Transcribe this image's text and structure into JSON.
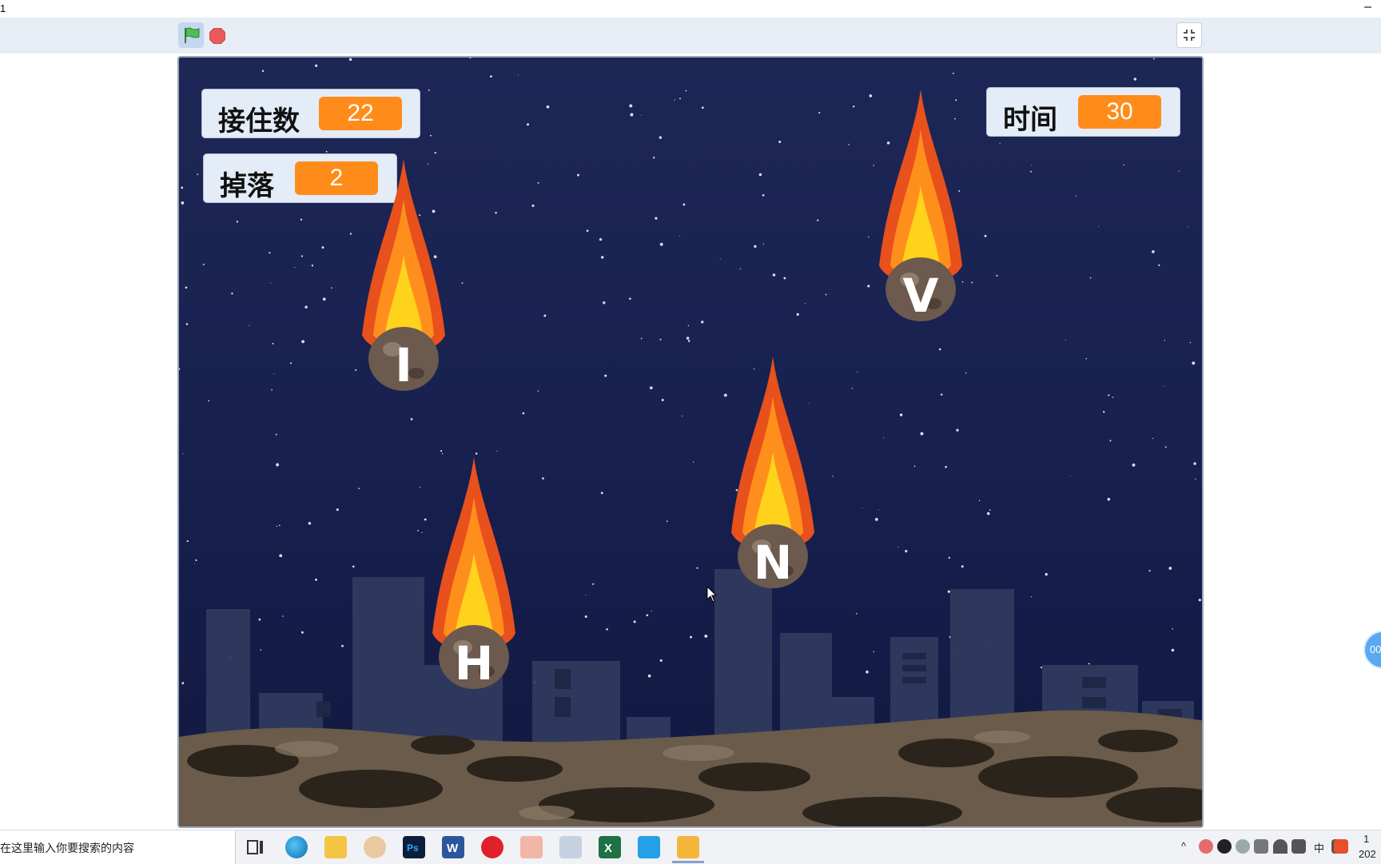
{
  "window": {
    "title": "1",
    "minimize_glyph": "–"
  },
  "toolbar": {
    "green_flag": "green-flag-icon",
    "stop": "stop-icon",
    "fullscreen_exit": "fullscreen-exit-icon"
  },
  "stage": {
    "monitors": [
      {
        "label": "接住数",
        "value": "22"
      },
      {
        "label": "掉落",
        "value": "2"
      },
      {
        "label": "时间",
        "value": "30"
      }
    ],
    "meteors": [
      {
        "letter": "I"
      },
      {
        "letter": "V"
      },
      {
        "letter": "N"
      },
      {
        "letter": "H"
      }
    ]
  },
  "side_widget": {
    "text": "00"
  },
  "taskbar": {
    "search_placeholder": "在这里输入你要搜索的内容",
    "tray_lang": "中",
    "clock_time": "1",
    "clock_date": "202"
  }
}
